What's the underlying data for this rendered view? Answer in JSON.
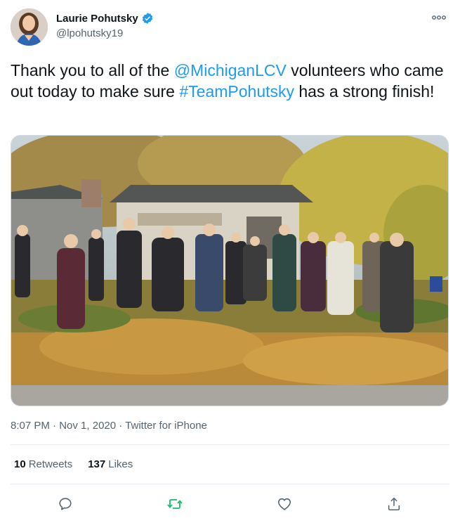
{
  "author": {
    "display_name": "Laurie Pohutsky",
    "handle": "@lpohutsky19"
  },
  "tweet": {
    "text_1": "Thank you to all of the ",
    "mention": "@MichiganLCV",
    "text_2": " volunteers who came out today to make sure ",
    "hashtag": "#TeamPohutsky",
    "text_3": " has a strong finish!"
  },
  "meta": {
    "time": "8:07 PM",
    "sep1": " · ",
    "date": "Nov 1, 2020",
    "sep2": " · ",
    "source": "Twitter for iPhone"
  },
  "stats": {
    "retweets_count": "10",
    "retweets_label": "Retweets",
    "likes_count": "137",
    "likes_label": "Likes"
  },
  "icons": {
    "reply": "reply-icon",
    "retweet": "retweet-icon",
    "like": "heart-icon",
    "share": "share-icon",
    "more": "more-icon",
    "verified": "verified-badge-icon"
  },
  "colors": {
    "link": "#1d9bf0",
    "retweet_active": "#17bf63",
    "secondary_text": "#536471"
  }
}
